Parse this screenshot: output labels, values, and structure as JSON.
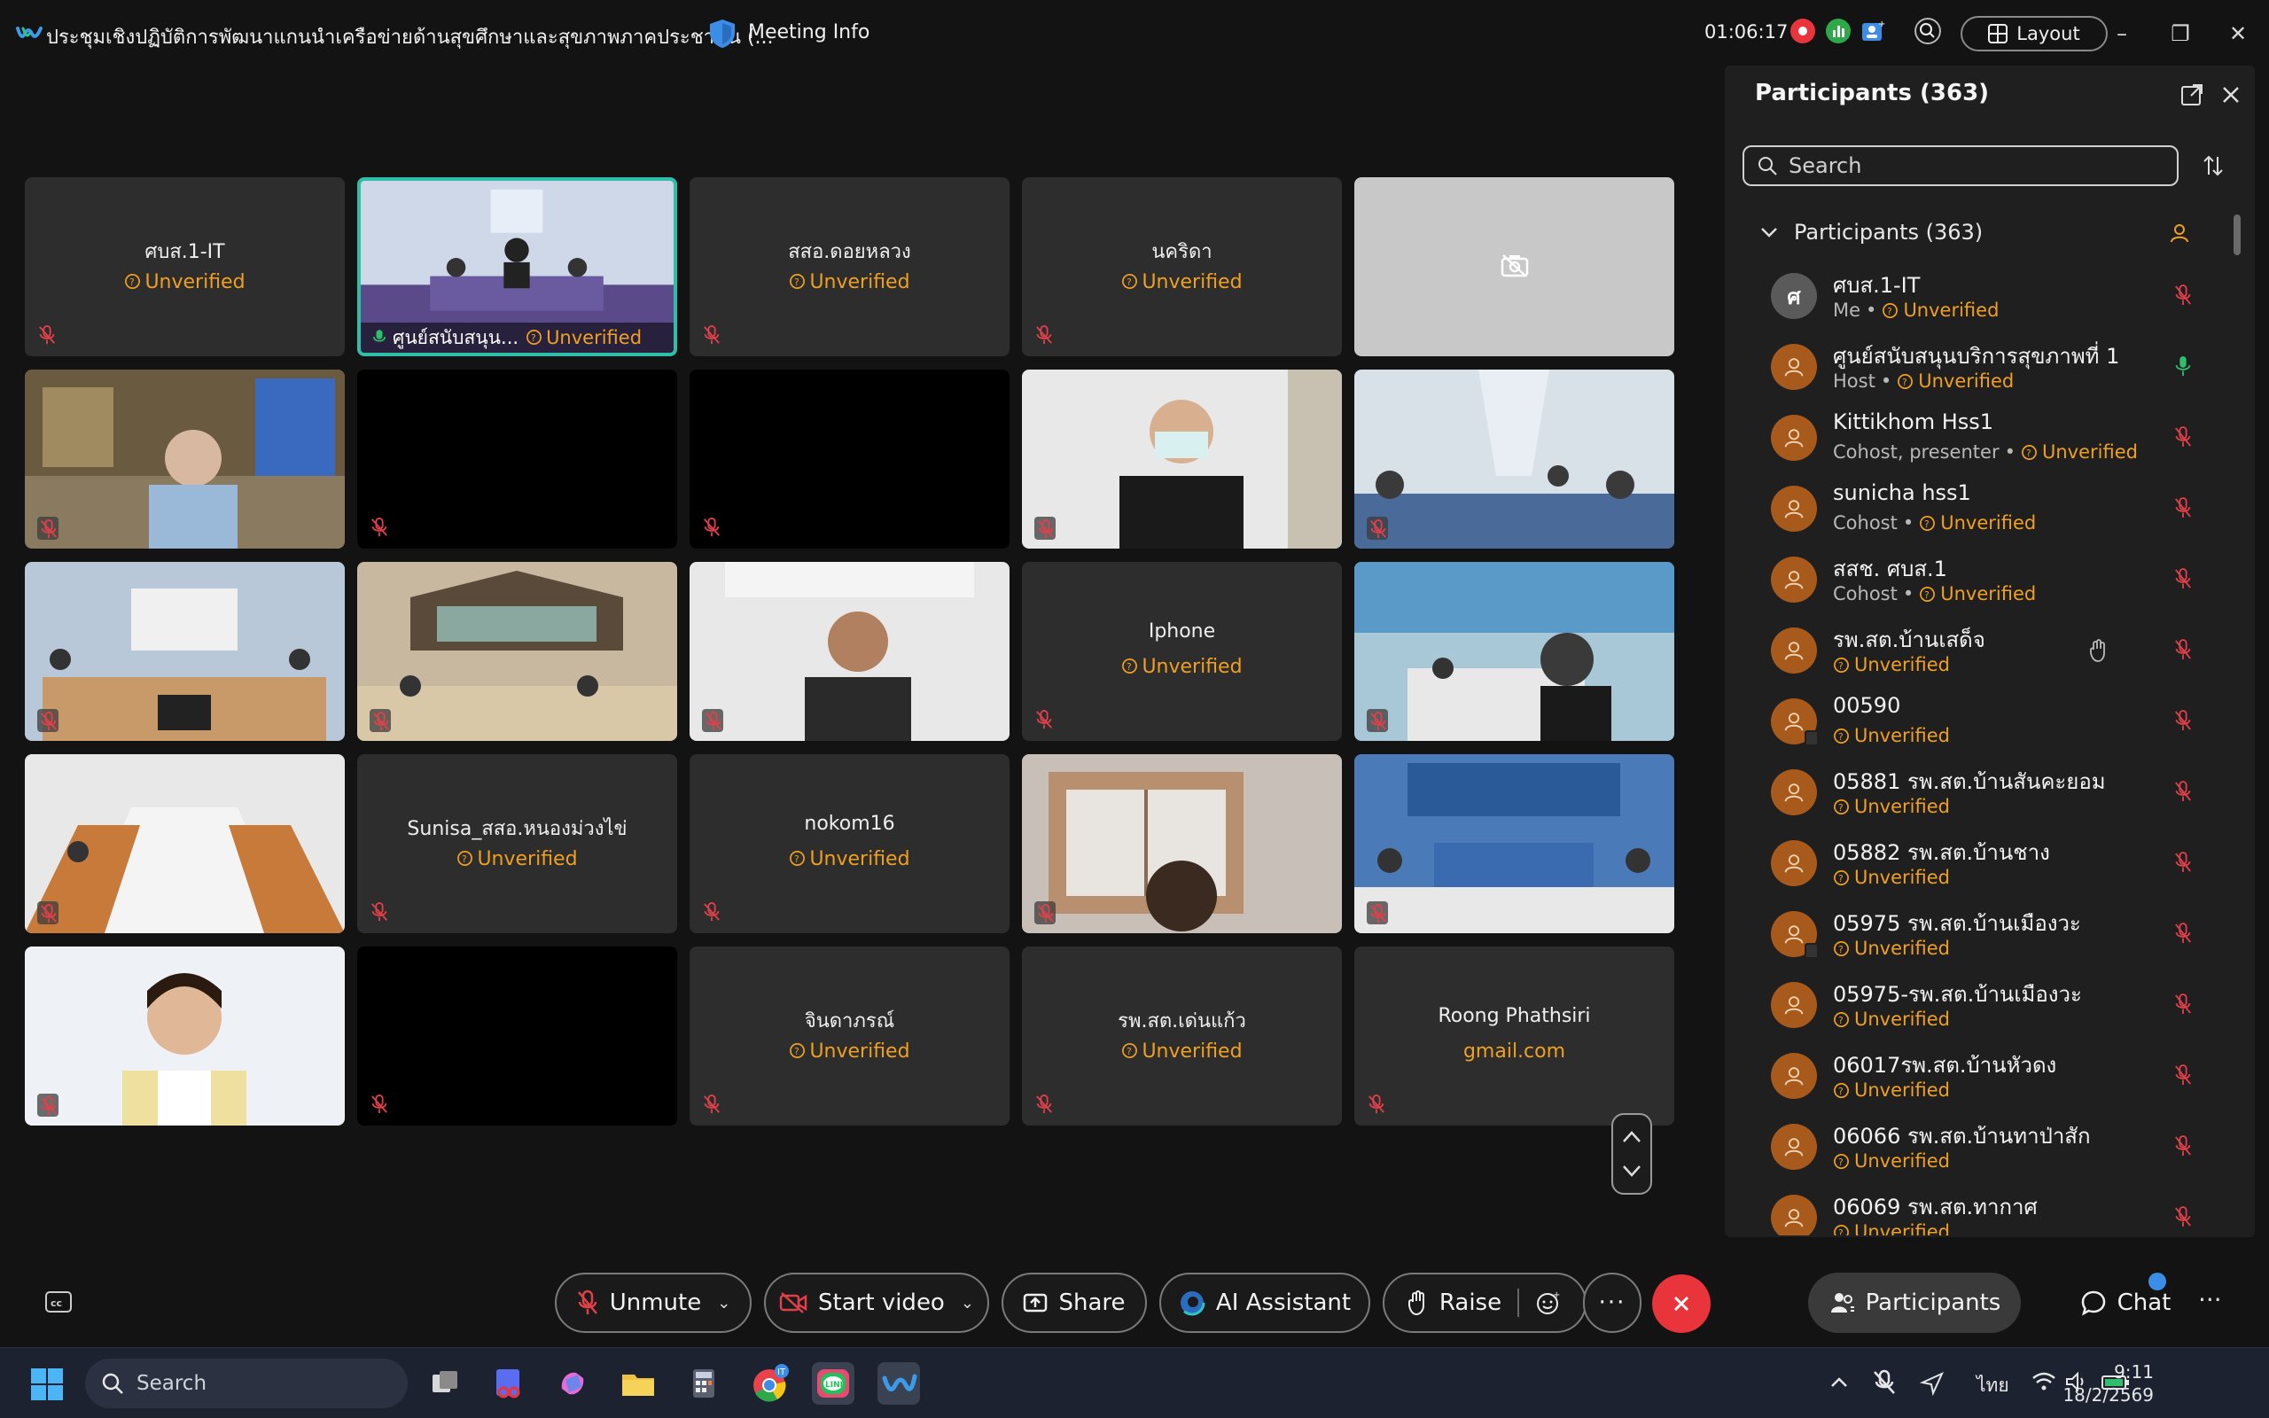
{
  "window": {
    "title": "ประชุมเชิงปฏิบัติการพัฒนาแกนนำเครือข่ายด้านสุขศึกษาและสุขภาพภาคประชาชน (...",
    "meeting_info": "Meeting Info",
    "timer": "01:06:17",
    "layout_label": "Layout"
  },
  "video_tiles": [
    {
      "name": "ศบส.1-IT",
      "sub": "Unverified",
      "type": "name"
    },
    {
      "name": "ศูนย์สนับสนุน...",
      "sub": "Unverified",
      "type": "video-active"
    },
    {
      "name": "สสอ.ดอยหลวง",
      "sub": "Unverified",
      "type": "name"
    },
    {
      "name": "นคริดา",
      "sub": "Unverified",
      "type": "name"
    },
    {
      "name": "",
      "sub": "",
      "type": "cam-off"
    },
    {
      "name": "",
      "sub": "",
      "type": "video"
    },
    {
      "name": "",
      "sub": "",
      "type": "black"
    },
    {
      "name": "",
      "sub": "",
      "type": "black"
    },
    {
      "name": "",
      "sub": "",
      "type": "video"
    },
    {
      "name": "",
      "sub": "",
      "type": "video"
    },
    {
      "name": "",
      "sub": "",
      "type": "video"
    },
    {
      "name": "",
      "sub": "",
      "type": "video"
    },
    {
      "name": "",
      "sub": "",
      "type": "video"
    },
    {
      "name": "Iphone",
      "sub": "Unverified",
      "type": "name"
    },
    {
      "name": "",
      "sub": "",
      "type": "video"
    },
    {
      "name": "",
      "sub": "",
      "type": "video"
    },
    {
      "name": "Sunisa_สสอ.หนองม่วงไข่",
      "sub": "Unverified",
      "type": "name"
    },
    {
      "name": "nokom16",
      "sub": "Unverified",
      "type": "name"
    },
    {
      "name": "",
      "sub": "",
      "type": "video"
    },
    {
      "name": "",
      "sub": "",
      "type": "video"
    },
    {
      "name": "",
      "sub": "",
      "type": "video"
    },
    {
      "name": "",
      "sub": "",
      "type": "black"
    },
    {
      "name": "จินดาภรณ์",
      "sub": "Unverified",
      "type": "name"
    },
    {
      "name": "รพ.สต.เด่นแก้ว",
      "sub": "Unverified",
      "type": "name"
    },
    {
      "name": "Roong Phathsiri",
      "sub": "gmail.com",
      "type": "name"
    }
  ],
  "panel": {
    "title": "Participants (363)",
    "search_placeholder": "Search",
    "group_label": "Participants (363)"
  },
  "participants": [
    {
      "name": "ศบส.1-IT",
      "role": "Me",
      "status": "Unverified",
      "avatar": "ศ"
    },
    {
      "name": "ศูนย์สนับสนุนบริการสุขภาพที่ 1",
      "role": "Host",
      "status": "Unverified"
    },
    {
      "name": "Kittikhom Hss1",
      "role": "Cohost, presenter",
      "status": "Unverified"
    },
    {
      "name": "sunicha hss1",
      "role": "Cohost",
      "status": "Unverified"
    },
    {
      "name": "สสช. ศบส.1",
      "role": "Cohost",
      "status": "Unverified"
    },
    {
      "name": "รพ.สต.บ้านเสด็จ",
      "role": "",
      "status": "Unverified"
    },
    {
      "name": "00590",
      "role": "",
      "status": "Unverified"
    },
    {
      "name": "05881 รพ.สต.บ้านสันคะยอม",
      "role": "",
      "status": "Unverified"
    },
    {
      "name": "05882 รพ.สต.บ้านชาง",
      "role": "",
      "status": "Unverified"
    },
    {
      "name": "05975 รพ.สต.บ้านเมืองวะ",
      "role": "",
      "status": "Unverified"
    },
    {
      "name": "05975-รพ.สต.บ้านเมืองวะ",
      "role": "",
      "status": "Unverified"
    },
    {
      "name": "06017รพ.สต.บ้านหัวดง",
      "role": "",
      "status": "Unverified"
    },
    {
      "name": "06066 รพ.สต.บ้านทาป่าสัก",
      "role": "",
      "status": "Unverified"
    },
    {
      "name": "06069 รพ.สต.ทากาศ",
      "role": "",
      "status": "Unverified"
    }
  ],
  "controls": {
    "unmute": "Unmute",
    "start_video": "Start video",
    "share": "Share",
    "ai_assistant": "AI Assistant",
    "raise": "Raise",
    "participants": "Participants",
    "chat": "Chat"
  },
  "taskbar": {
    "search_label": "Search",
    "language": "ไทย",
    "time": "9:11",
    "date": "18/2/2569"
  },
  "colors": {
    "unverified": "#f0a020",
    "active_border": "#2fbfa8",
    "end_call": "#e8343a",
    "avatar": "#a85a1c",
    "muted_mic": "#e0404a",
    "unmuted_mic": "#2fbf6a"
  }
}
